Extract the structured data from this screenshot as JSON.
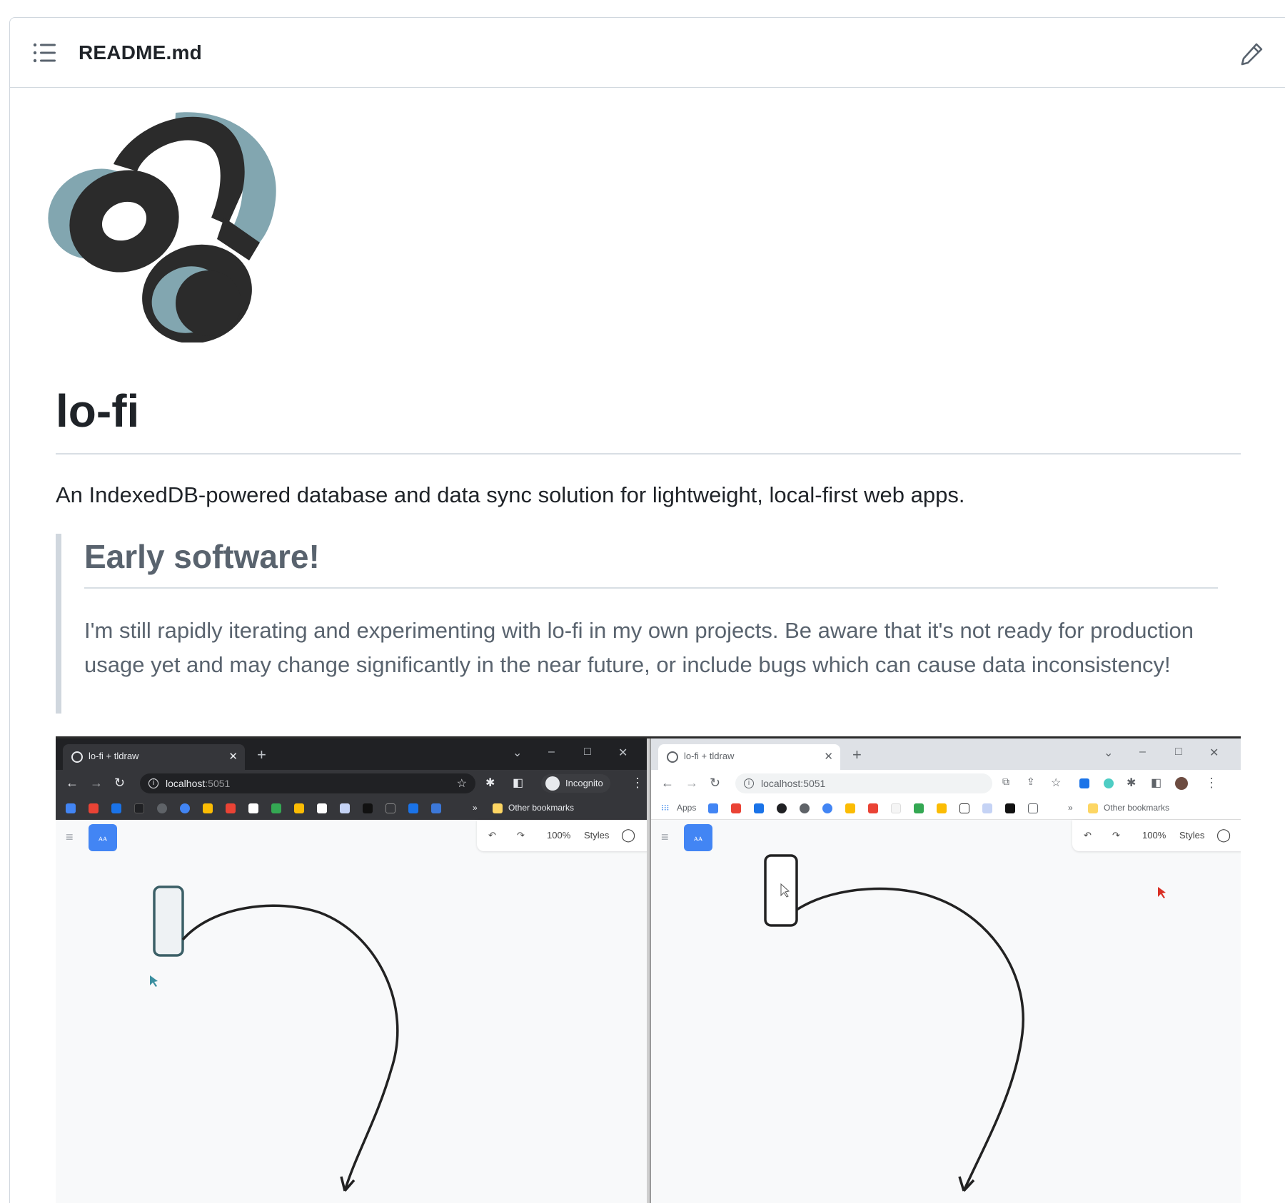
{
  "readme": {
    "filename": "README.md"
  },
  "content": {
    "title": "lo-fi",
    "intro": "An IndexedDB-powered database and data sync solution for lightweight, local-first web apps.",
    "warning_heading": "Early software!",
    "warning_text": "I'm still rapidly iterating and experimenting with lo-fi in my own projects. Be aware that it's not ready for production usage yet and may change significantly in the near future, or include bugs which can cause data inconsistency!"
  },
  "colors": {
    "logo_dark": "#2b2b2b",
    "logo_accent": "#82a6b0",
    "text_primary": "#1f2328",
    "text_muted": "#59636e",
    "border": "#d0d7de"
  },
  "icons": {
    "toc": "list-icon",
    "edit": "pencil-icon",
    "logo": "headphones-logo"
  },
  "demo": {
    "left_window": {
      "tab_title": "lo-fi + tldraw",
      "url_host": "localhost",
      "url_port": ":5051",
      "profile_label": "Incognito",
      "other_bookmarks": "Other bookmarks",
      "zoom": "100%",
      "styles_label": "Styles"
    },
    "right_window": {
      "tab_title": "lo-fi + tldraw",
      "url_host": "localhost",
      "url_port": ":5051",
      "apps_label": "Apps",
      "other_bookmarks": "Other bookmarks",
      "zoom": "100%",
      "styles_label": "Styles"
    }
  }
}
